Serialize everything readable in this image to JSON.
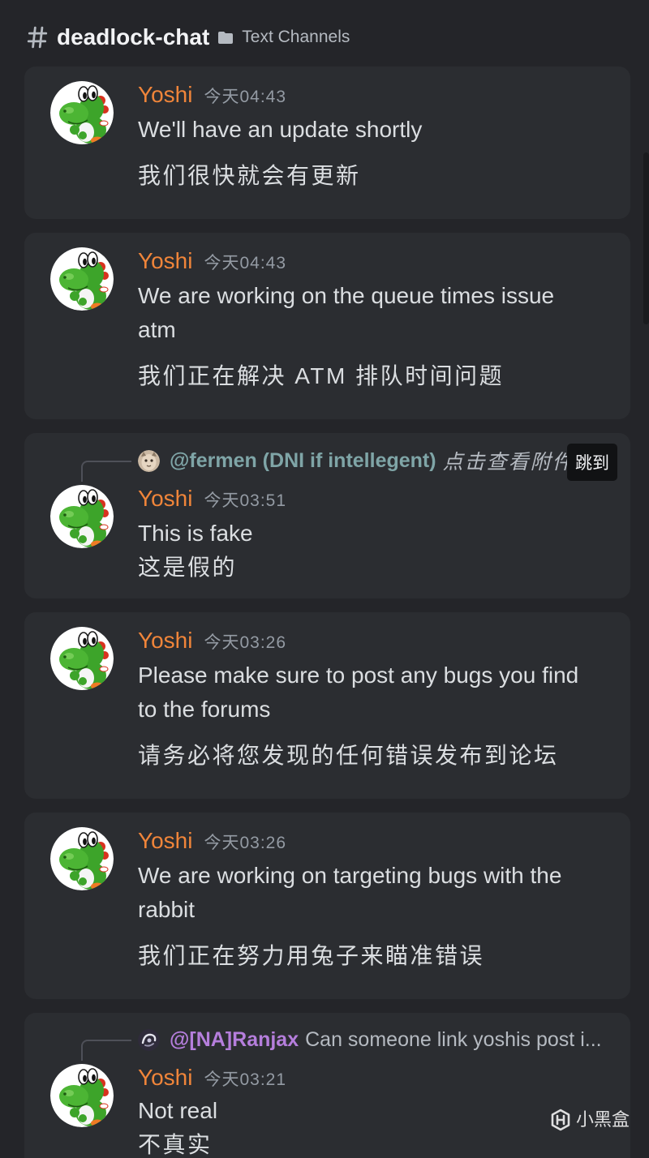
{
  "header": {
    "channel_icon": "hash-icon",
    "channel_name": "deadlock-chat",
    "category_icon": "folder-icon",
    "category": "Text Channels"
  },
  "colors": {
    "background": "#242529",
    "card": "#2b2d31",
    "message_text": "#dbdee1",
    "timestamp": "#949ba4",
    "reply_connector": "#4e5058",
    "jump_button": "#111214"
  },
  "messages": [
    {
      "avatar": "yoshi-avatar",
      "author": "Yoshi",
      "author_color": "#f0853a",
      "timestamp": "今天04:43",
      "lines": [
        "We'll have an update shortly"
      ],
      "translation": "我们很快就会有更新"
    },
    {
      "avatar": "yoshi-avatar",
      "author": "Yoshi",
      "author_color": "#f0853a",
      "timestamp": "今天04:43",
      "lines": [
        "We are working on the queue times issue atm"
      ],
      "translation": "我们正在解决 ATM 排队时间问题"
    },
    {
      "reply": {
        "avatar": "fermen-avatar",
        "author": "@fermen (DNI if intellegent)",
        "author_color": "#7fa5a7",
        "text": "点击查看附件",
        "jump_label": "跳到"
      },
      "avatar": "yoshi-avatar",
      "author": "Yoshi",
      "author_color": "#f0853a",
      "timestamp": "今天03:51",
      "lines": [
        "This is fake",
        "这是假的"
      ]
    },
    {
      "avatar": "yoshi-avatar",
      "author": "Yoshi",
      "author_color": "#f0853a",
      "timestamp": "今天03:26",
      "lines": [
        "Please make sure to post any bugs you find to the forums"
      ],
      "translation": "请务必将您发现的任何错误发布到论坛"
    },
    {
      "avatar": "yoshi-avatar",
      "author": "Yoshi",
      "author_color": "#f0853a",
      "timestamp": "今天03:26",
      "lines": [
        "We are working on targeting bugs with the rabbit"
      ],
      "translation": "我们正在努力用兔子来瞄准错误"
    },
    {
      "reply": {
        "avatar": "ranjax-avatar",
        "author": "@[NA]Ranjax",
        "author_color": "#b57edc",
        "text": "Can someone link yoshis post i..."
      },
      "avatar": "yoshi-avatar",
      "author": "Yoshi",
      "author_color": "#f0853a",
      "timestamp": "今天03:21",
      "lines": [
        "Not real",
        "不真实"
      ]
    }
  ],
  "watermark": {
    "icon": "xiaoheihe-logo-icon",
    "text": "小黑盒"
  }
}
